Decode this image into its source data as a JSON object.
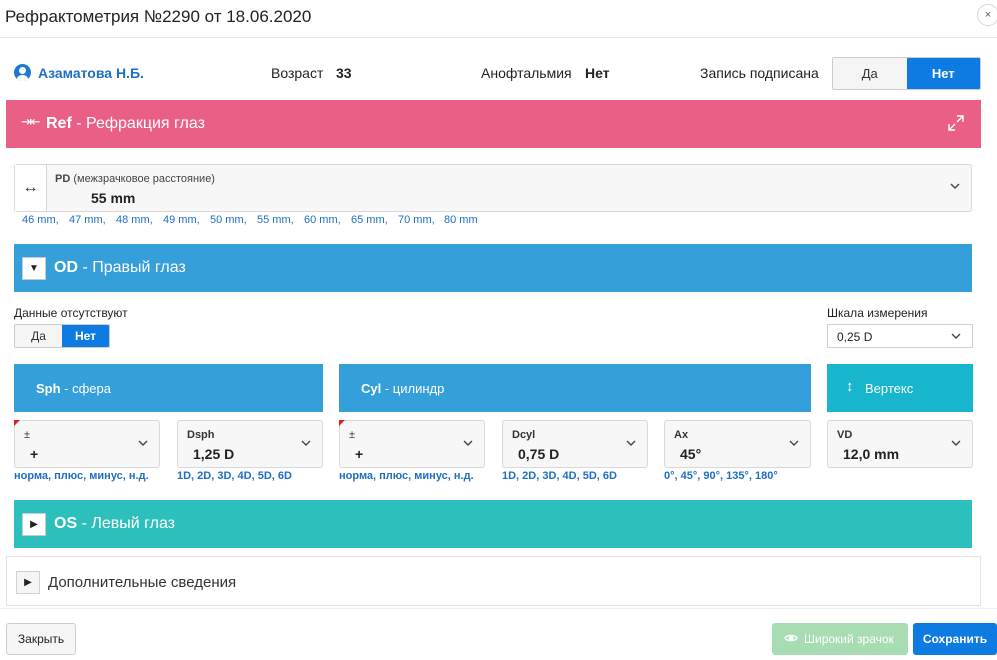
{
  "window": {
    "title": "Рефрактометрия №2290 от 18.06.2020",
    "close_icon": "×"
  },
  "patient": {
    "name": "Азаматова Н.Б.",
    "age_label": "Возраст",
    "age_value": "33",
    "anophthalmia_label": "Анофтальмия",
    "anophthalmia_value": "Нет",
    "signed_label": "Запись подписана",
    "signed_options": [
      "Да",
      "Нет"
    ],
    "signed_selected": "Нет"
  },
  "ref_section": {
    "icon": "⇥⇤",
    "code": "Ref",
    "title": " - Рефракция глаз",
    "accent_color": "#e95f86"
  },
  "pd": {
    "icon": "↔",
    "label": "PD",
    "label_hint": " (межзрачковое расстояние)",
    "value": "55 mm",
    "options": [
      "46 mm,",
      "47 mm,",
      "48 mm,",
      "49 mm,",
      "50 mm,",
      "55 mm,",
      "60 mm,",
      "65 mm,",
      "70 mm,",
      "80 mm"
    ]
  },
  "od": {
    "toggle_icon": "▼",
    "code": "OD",
    "title": " - Правый глаз",
    "no_data_label": "Данные отсутствуют",
    "no_data_options": [
      "Да",
      "Нет"
    ],
    "no_data_selected": "Нет",
    "scale_label": "Шкала измерения",
    "scale_value": "0,25 D",
    "sph_tile": {
      "code": "Sph",
      "title": " - сфера"
    },
    "cyl_tile": {
      "code": "Cyl",
      "title": " - цилиндр"
    },
    "vertex_tile": {
      "icon": "↕",
      "title": "Вертекс"
    },
    "sph_sign": {
      "label": "±",
      "value": "+",
      "hint": "норма, плюс, минус, н.д."
    },
    "dsph": {
      "label": "Dsph",
      "value": "1,25 D",
      "hint": "1D, 2D, 3D, 4D, 5D, 6D"
    },
    "cyl_sign": {
      "label": "±",
      "value": "+",
      "hint": "норма, плюс, минус, н.д."
    },
    "dcyl": {
      "label": "Dcyl",
      "value": "0,75 D",
      "hint": "1D, 2D, 3D, 4D, 5D, 6D"
    },
    "ax": {
      "label": "Ax",
      "value": "45°",
      "hint": "0°, 45°, 90°, 135°, 180°"
    },
    "vd": {
      "label": "VD",
      "value": "12,0 mm"
    }
  },
  "os": {
    "toggle_icon": "▶",
    "code": "OS",
    "title": " - Левый глаз",
    "accent_color": "#2dbfbb"
  },
  "extra": {
    "toggle_icon": "▶",
    "title": "Дополнительные сведения"
  },
  "footer": {
    "close_label": "Закрыть",
    "wide_pupil_label": "Широкий зрачок",
    "save_label": "Сохранить"
  },
  "colors": {
    "primary": "#0d7be2",
    "section_blue": "#349fd9",
    "vertex_teal": "#17b6cd",
    "disabled_green": "#a8dcb3"
  }
}
